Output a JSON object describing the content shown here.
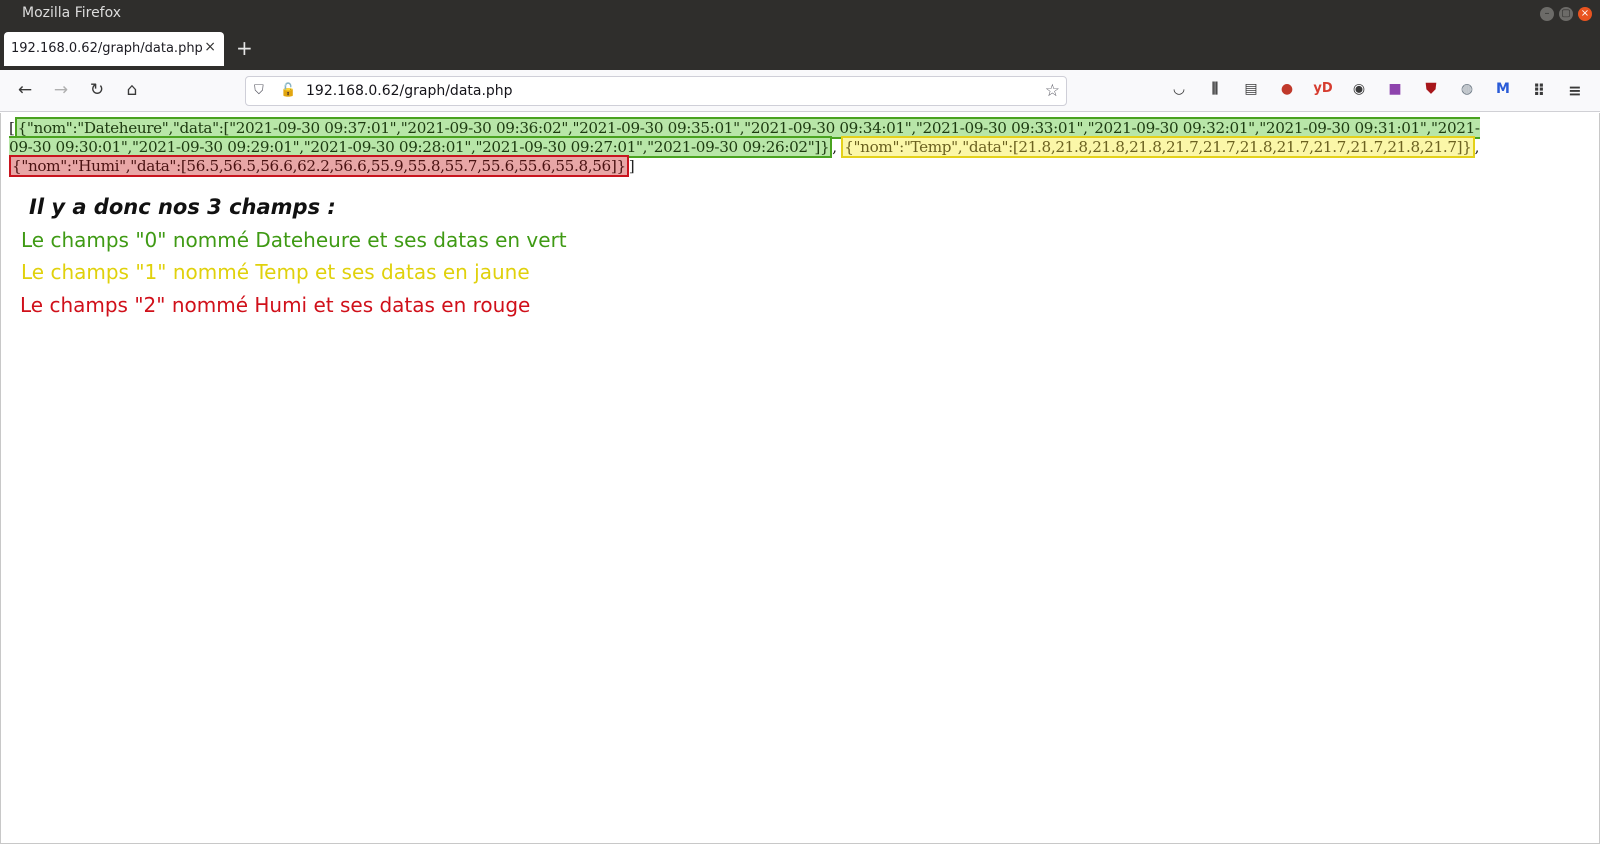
{
  "window": {
    "title": "Mozilla Firefox"
  },
  "tab": {
    "title": "192.168.0.62/graph/data.php",
    "close": "×"
  },
  "newtab": {
    "label": "+"
  },
  "nav": {
    "back": "←",
    "forward": "→",
    "reload": "↻",
    "home": "⌂"
  },
  "urlbar": {
    "url": "192.168.0.62/graph/data.php",
    "shield": "⛉",
    "lock": "🔓",
    "bookmark_icon": "☆"
  },
  "toolbar_icons": [
    "pocket-icon",
    "library-icon",
    "sidebar-icon",
    "extension-icon",
    "yd-icon",
    "extension-icon-2",
    "extension-icon-3",
    "ublock-icon",
    "extension-icon-4",
    "extension-icon-5",
    "apps-grid-icon",
    "menu-icon"
  ],
  "json_text": {
    "open_bracket": "[",
    "green": "{\"nom\":\"Dateheure\",\"data\":[\"2021-09-30 09:37:01\",\"2021-09-30 09:36:02\",\"2021-09-30 09:35:01\",\"2021-09-30 09:34:01\",\"2021-09-30 09:33:01\",\"2021-09-30 09:32:01\",\"2021-09-30 09:31:01\",\"2021-09-30 09:30:01\",\"2021-09-30 09:29:01\",\"2021-09-30 09:28:01\",\"2021-09-30 09:27:01\",\"2021-09-30 09:26:02\"]}",
    "sep1": ",",
    "yellow": "{\"nom\":\"Temp\",\"data\":[21.8,21.8,21.8,21.8,21.7,21.7,21.8,21.7,21.7,21.7,21.8,21.7]}",
    "sep2": ",",
    "red": "{\"nom\":\"Humi\",\"data\":[56.5,56.5,56.6,62.2,56.6,55.9,55.8,55.7,55.6,55.6,55.8,56]}",
    "close_bracket": "]"
  },
  "notes": {
    "heading": "Il y a donc nos 3 champs  :",
    "green": "Le champs \"0\" nommé  Dateheure et ses datas en vert",
    "yellow": "Le champs \"1\" nommé Temp et ses datas en jaune",
    "red": "Le champs \"2\" nommé Humi et ses datas en rouge"
  },
  "colors": {
    "green": "#4aa320",
    "yellow": "#e4d11a",
    "red": "#c8141e"
  }
}
